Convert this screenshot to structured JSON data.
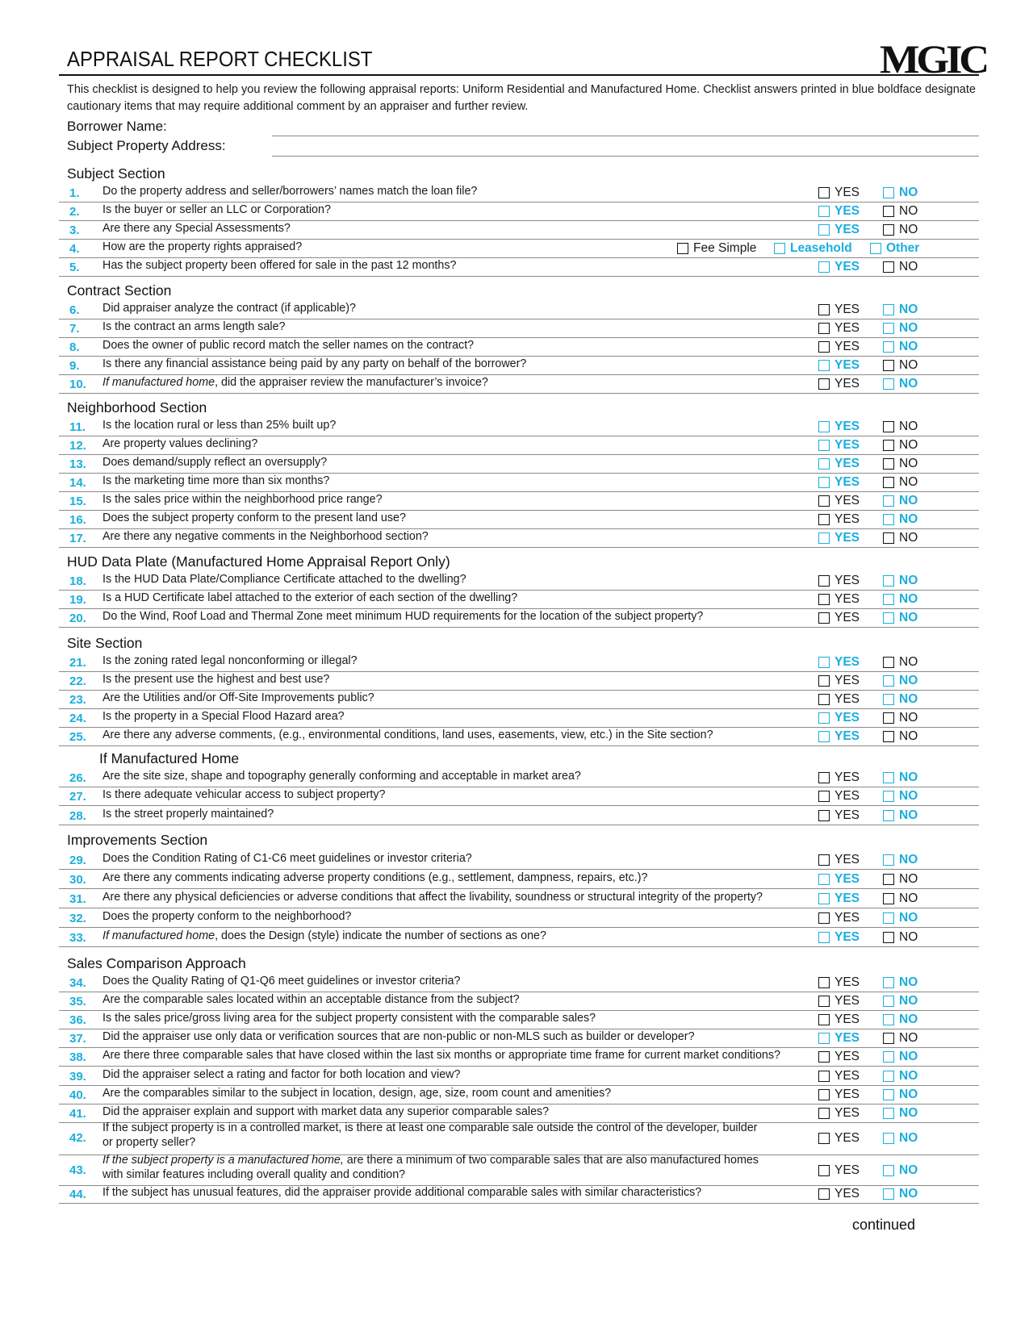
{
  "header": {
    "title": "APPRAISAL REPORT CHECKLIST",
    "logo": "MGIC",
    "intro": "This checklist is designed to help you review the following appraisal reports: Uniform Residential and Manufactured Home. Checklist answers printed in blue boldface designate cautionary items that may require additional comment by an appraiser and further review."
  },
  "fields": {
    "borrower_label": "Borrower Name:",
    "borrower_value": "",
    "address_label": "Subject Property Address:",
    "address_value": ""
  },
  "colors": {
    "caution": "#1aaede",
    "text": "#1a1a1a",
    "rule": "#8a8a8a"
  },
  "sections": [
    {
      "title": "Subject Section",
      "items": [
        {
          "n": "1.",
          "q": "Do the property address and seller/borrowers’ names match the loan file?",
          "yes": "YES",
          "no": "NO",
          "caution": "no"
        },
        {
          "n": "2.",
          "q": "Is the buyer or seller an LLC or Corporation?",
          "yes": "YES",
          "no": "NO",
          "caution": "yes"
        },
        {
          "n": "3.",
          "q": "Are there any Special Assessments?",
          "yes": "YES",
          "no": "NO",
          "caution": "yes"
        },
        {
          "n": "4.",
          "q": "How are the property rights appraised?",
          "options": [
            {
              "label": "Fee Simple",
              "caution": false
            },
            {
              "label": "Leasehold",
              "caution": true
            },
            {
              "label": "Other",
              "caution": true
            }
          ]
        },
        {
          "n": "5.",
          "q": "Has the subject property been offered for sale in the past 12 months?",
          "yes": "YES",
          "no": "NO",
          "caution": "yes"
        }
      ]
    },
    {
      "title": "Contract Section",
      "items": [
        {
          "n": "6.",
          "q": "Did appraiser analyze the contract (if applicable)?",
          "yes": "YES",
          "no": "NO",
          "caution": "no"
        },
        {
          "n": "7.",
          "q": "Is the contract an arms length sale?",
          "yes": "YES",
          "no": "NO",
          "caution": "no"
        },
        {
          "n": "8.",
          "q": "Does the owner of public record match the seller names on the contract?",
          "yes": "YES",
          "no": "NO",
          "caution": "no"
        },
        {
          "n": "9.",
          "q": "Is there any financial assistance being paid by any party on behalf of the borrower?",
          "yes": "YES",
          "no": "NO",
          "caution": "yes"
        },
        {
          "n": "10.",
          "q_italic": "If manufactured home",
          "q": ", did the appraiser review the manufacturer’s invoice?",
          "yes": "YES",
          "no": "NO",
          "caution": "no"
        }
      ]
    },
    {
      "title": "Neighborhood Section",
      "items": [
        {
          "n": "11.",
          "q": "Is the location rural or less than 25% built up?",
          "yes": "YES",
          "no": "NO",
          "caution": "yes"
        },
        {
          "n": "12.",
          "q": "Are property values declining?",
          "yes": "YES",
          "no": "NO",
          "caution": "yes"
        },
        {
          "n": "13.",
          "q": "Does demand/supply reflect an oversupply?",
          "yes": "YES",
          "no": "NO",
          "caution": "yes"
        },
        {
          "n": "14.",
          "q": "Is the marketing time more than six months?",
          "yes": "YES",
          "no": "NO",
          "caution": "yes"
        },
        {
          "n": "15.",
          "q": "Is the sales price within the neighborhood price range?",
          "yes": "YES",
          "no": "NO",
          "caution": "no"
        },
        {
          "n": "16.",
          "q": "Does the subject property conform to the present land use?",
          "yes": "YES",
          "no": "NO",
          "caution": "no"
        },
        {
          "n": "17.",
          "q": "Are there any negative comments in the Neighborhood section?",
          "yes": "YES",
          "no": "NO",
          "caution": "yes"
        }
      ]
    },
    {
      "title": "HUD Data Plate (Manufactured Home Appraisal Report Only)",
      "items": [
        {
          "n": "18.",
          "q": "Is the HUD Data Plate/Compliance Certificate attached to the dwelling?",
          "yes": "YES",
          "no": "NO",
          "caution": "no"
        },
        {
          "n": "19.",
          "q": "Is a HUD Certificate label attached to the exterior of each section of the dwelling?",
          "yes": "YES",
          "no": "NO",
          "caution": "no"
        },
        {
          "n": "20.",
          "q": "Do the Wind, Roof Load and Thermal Zone meet minimum HUD requirements for the location of the subject property?",
          "yes": "YES",
          "no": "NO",
          "caution": "no"
        }
      ]
    },
    {
      "title": "Site Section",
      "items": [
        {
          "n": "21.",
          "q": "Is the zoning rated legal nonconforming or illegal?",
          "yes": "YES",
          "no": "NO",
          "caution": "yes"
        },
        {
          "n": "22.",
          "q": "Is the present use the highest and best use?",
          "yes": "YES",
          "no": "NO",
          "caution": "no"
        },
        {
          "n": "23.",
          "q": "Are the Utilities and/or Off-Site Improvements public?",
          "yes": "YES",
          "no": "NO",
          "caution": "no"
        },
        {
          "n": "24.",
          "q": "Is the property in a Special Flood Hazard area?",
          "yes": "YES",
          "no": "NO",
          "caution": "yes"
        },
        {
          "n": "25.",
          "q": "Are there any adverse comments, (e.g., environmental conditions, land uses, easements, view, etc.) in the Site section?",
          "yes": "YES",
          "no": "NO",
          "caution": "yes"
        }
      ]
    },
    {
      "title": "If Manufactured Home",
      "indent": true,
      "items": [
        {
          "n": "26.",
          "q": "Are the site size, shape and topography generally conforming and acceptable in market area?",
          "yes": "YES",
          "no": "NO",
          "caution": "no"
        },
        {
          "n": "27.",
          "q": "Is there adequate vehicular access to subject property?",
          "yes": "YES",
          "no": "NO",
          "caution": "no"
        },
        {
          "n": "28.",
          "q": "Is the street properly maintained?",
          "yes": "YES",
          "no": "NO",
          "caution": "no"
        }
      ]
    },
    {
      "title": "Improvements Section",
      "items": [
        {
          "n": "29.",
          "q": "Does the Condition Rating of C1-C6 meet guidelines or investor criteria?",
          "yes": "YES",
          "no": "NO",
          "caution": "no"
        },
        {
          "n": "30.",
          "q": "Are there any comments indicating adverse property conditions (e.g., settlement, dampness, repairs, etc.)?",
          "yes": "YES",
          "no": "NO",
          "caution": "yes"
        },
        {
          "n": "31.",
          "q": "Are there any physical deficiencies or adverse conditions that affect the livability, soundness or structural integrity of the property?",
          "yes": "YES",
          "no": "NO",
          "caution": "yes"
        },
        {
          "n": "32.",
          "q": "Does the property conform to the neighborhood?",
          "yes": "YES",
          "no": "NO",
          "caution": "no"
        },
        {
          "n": "33.",
          "q_italic": "If manufactured home",
          "q": ", does the Design (style) indicate the number of sections as one?",
          "yes": "YES",
          "no": "NO",
          "caution": "yes"
        }
      ]
    },
    {
      "title": "Sales Comparison Approach",
      "items": [
        {
          "n": "34.",
          "q": "Does the Quality Rating of Q1-Q6 meet guidelines or investor criteria?",
          "yes": "YES",
          "no": "NO",
          "caution": "no"
        },
        {
          "n": "35.",
          "q": "Are the comparable sales located within an acceptable distance from the subject?",
          "yes": "YES",
          "no": "NO",
          "caution": "no"
        },
        {
          "n": "36.",
          "q": "Is the sales price/gross living area for the subject property consistent with the comparable sales?",
          "yes": "YES",
          "no": "NO",
          "caution": "no"
        },
        {
          "n": "37.",
          "q": "Did the appraiser use only data or verification sources that are non-public or non-MLS such as builder or developer?",
          "yes": "YES",
          "no": "NO",
          "caution": "yes"
        },
        {
          "n": "38.",
          "q": "Are there three comparable sales that have closed within the last six months or appropriate time frame for current market conditions?",
          "yes": "YES",
          "no": "NO",
          "caution": "no"
        },
        {
          "n": "39.",
          "q": "Did the appraiser select a rating and factor for both location and view?",
          "yes": "YES",
          "no": "NO",
          "caution": "no"
        },
        {
          "n": "40.",
          "q": "Are the comparables similar to the subject in location, design, age, size, room count and amenities?",
          "yes": "YES",
          "no": "NO",
          "caution": "no"
        },
        {
          "n": "41.",
          "q": "Did the appraiser explain and support with market data any superior comparable sales?",
          "yes": "YES",
          "no": "NO",
          "caution": "no"
        },
        {
          "n": "42.",
          "q": "If the subject property is in a controlled market, is there at least one comparable sale outside the control of the developer, builder",
          "q2": "or property seller?",
          "yes": "YES",
          "no": "NO",
          "caution": "no"
        },
        {
          "n": "43.",
          "q_italic": "If the subject property is a manufactured home,",
          "q": " are there a minimum of two comparable sales that are also manufactured homes",
          "q2": "with similar features including overall quality and condition?",
          "yes": "YES",
          "no": "NO",
          "caution": "no"
        },
        {
          "n": "44.",
          "q": "If the subject has unusual features, did the appraiser provide additional comparable sales with similar characteristics?",
          "yes": "YES",
          "no": "NO",
          "caution": "no"
        }
      ]
    }
  ],
  "footer": {
    "continued": "continued"
  }
}
